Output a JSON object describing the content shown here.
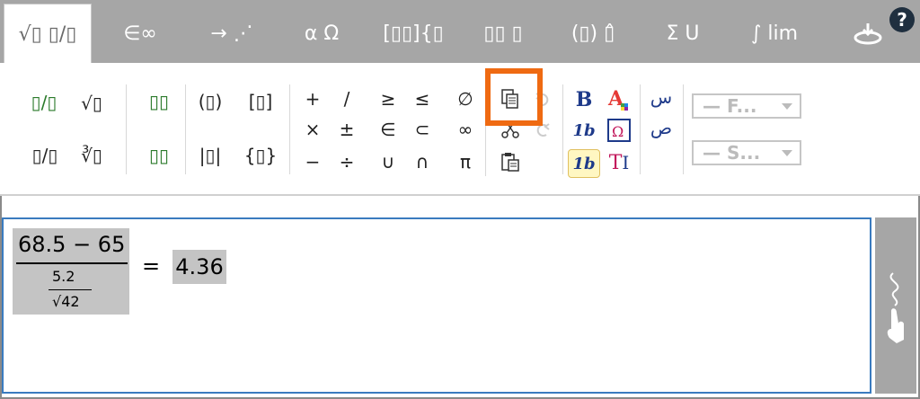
{
  "tabs": [
    {
      "label": "√▯ ▯/▯"
    },
    {
      "label": "∈∞"
    },
    {
      "label": "→ ⋰"
    },
    {
      "label": "α Ω"
    },
    {
      "label": "[▯▯]{▯"
    },
    {
      "label": "▯▯ ▯"
    },
    {
      "label": "(▯) ▯̂"
    },
    {
      "label": "Σ U"
    },
    {
      "label": "∫ lim"
    },
    {
      "label": ""
    }
  ],
  "help_label": "?",
  "ribbon": {
    "group1": [
      "▯/▯",
      "√▯",
      "▯/▯",
      "∛▯"
    ],
    "group2": [
      "▯▯",
      "▯▯"
    ],
    "group3": [
      "(▯)",
      "[▯]",
      "|▯|",
      "{▯}"
    ],
    "operators": [
      "+",
      "/",
      "×",
      "±",
      "−",
      "÷"
    ],
    "relations": [
      "≥",
      "≤",
      "∈",
      "⊂",
      "∪",
      "∩"
    ],
    "symbols": [
      "∅",
      "∞",
      "π"
    ],
    "bold_label": "B",
    "italic_label": "1b",
    "italic_label2": "1b",
    "text_label": "T",
    "font_select": "— F...",
    "size_select": "— S...",
    "arabic1": "س",
    "arabic2": "ص"
  },
  "editor": {
    "numerator": "68.5 − 65",
    "inner_numerator": "5.2",
    "inner_denominator": "√42",
    "equals": "=",
    "result": "4.36"
  }
}
